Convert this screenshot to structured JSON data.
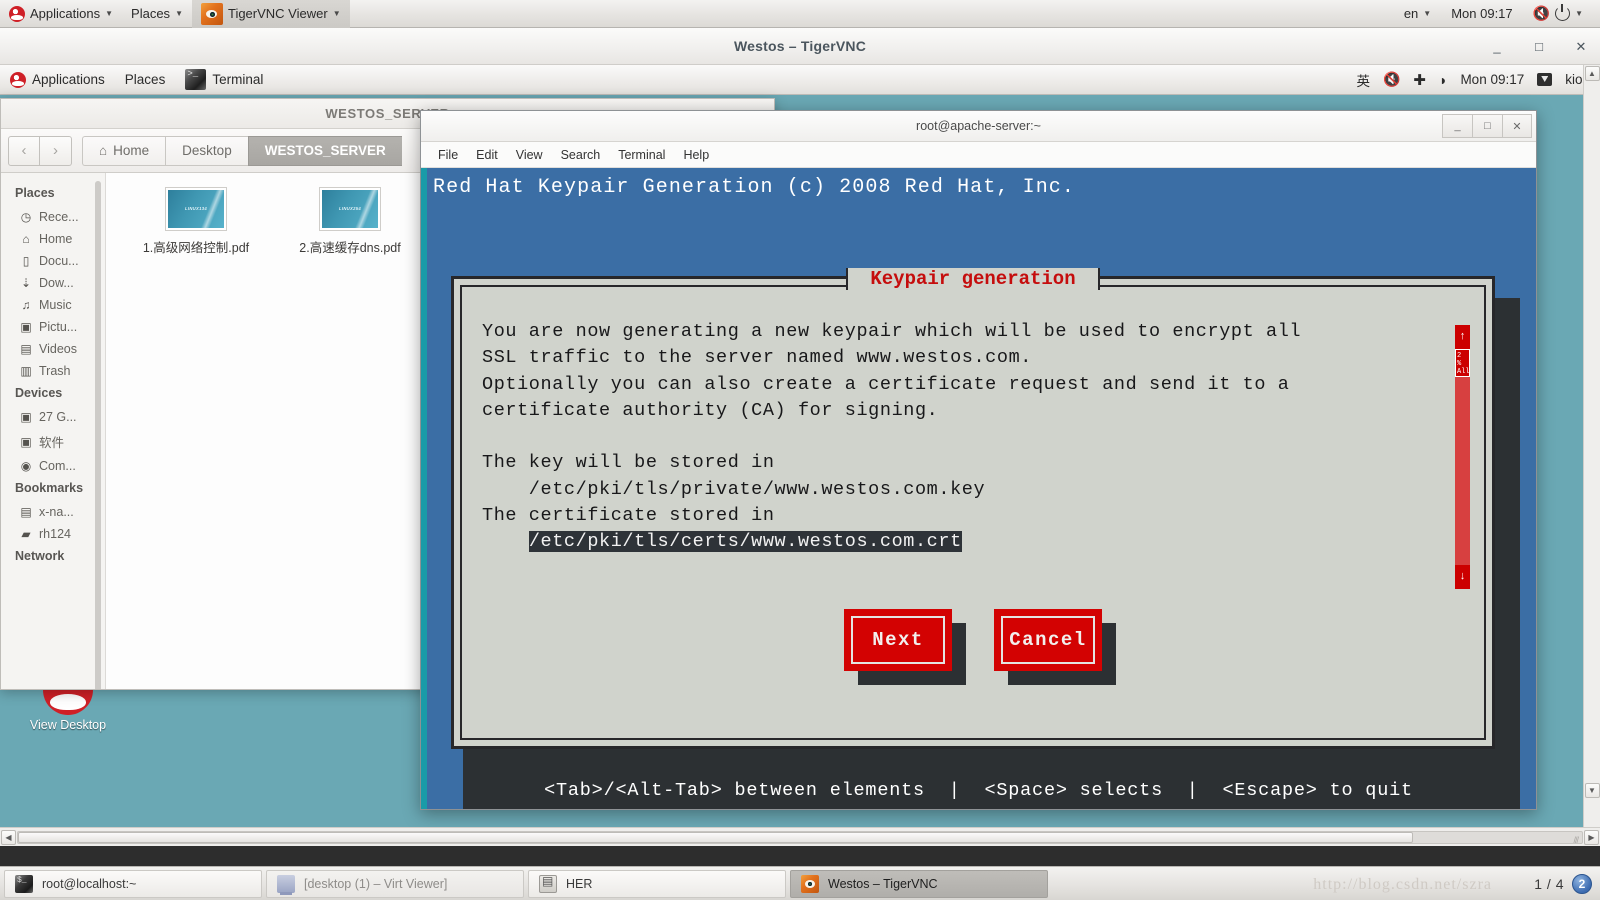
{
  "host_panel": {
    "applications": "Applications",
    "places": "Places",
    "app_window": "TigerVNC Viewer",
    "keyboard": "en",
    "clock": "Mon 09:17"
  },
  "vnc_window": {
    "title": "Westos – TigerVNC",
    "minimize": "_",
    "maximize": "□",
    "close": "✕"
  },
  "guest_panel": {
    "applications": "Applications",
    "places": "Places",
    "window": "Terminal",
    "ime": "英",
    "clock": "Mon 09:17",
    "user": "kiosk"
  },
  "desktop": {
    "icon_label": "View Desktop"
  },
  "file_manager": {
    "title": "WESTOS_SERVER",
    "minimize": "_",
    "close": "⌄",
    "back": "‹",
    "forward": "›",
    "breadcrumbs": [
      {
        "label": "Home",
        "icon": "home-icon",
        "active": false
      },
      {
        "label": "Desktop",
        "icon": "",
        "active": false
      },
      {
        "label": "WESTOS_SERVER",
        "icon": "",
        "active": true
      }
    ],
    "sidebar": [
      {
        "type": "header",
        "label": "Places"
      },
      {
        "type": "item",
        "label": "Rece...",
        "icon": "recent-icon"
      },
      {
        "type": "item",
        "label": "Home",
        "icon": "home-icon"
      },
      {
        "type": "item",
        "label": "Docu...",
        "icon": "document-icon"
      },
      {
        "type": "item",
        "label": "Dow...",
        "icon": "download-icon"
      },
      {
        "type": "item",
        "label": "Music",
        "icon": "music-icon"
      },
      {
        "type": "item",
        "label": "Pictu...",
        "icon": "camera-icon"
      },
      {
        "type": "item",
        "label": "Videos",
        "icon": "film-icon"
      },
      {
        "type": "item",
        "label": "Trash",
        "icon": "trash-icon"
      },
      {
        "type": "header",
        "label": "Devices"
      },
      {
        "type": "item",
        "label": "27 G...",
        "icon": "drive-icon"
      },
      {
        "type": "item",
        "label": "软件",
        "icon": "drive-icon"
      },
      {
        "type": "item",
        "label": "Com...",
        "icon": "disc-icon"
      },
      {
        "type": "header",
        "label": "Bookmarks"
      },
      {
        "type": "item",
        "label": "x-na...",
        "icon": "computer-icon"
      },
      {
        "type": "item",
        "label": "rh124",
        "icon": "folder-icon"
      },
      {
        "type": "header",
        "label": "Network"
      }
    ],
    "files": [
      {
        "name": "1.高级网络控制.pdf",
        "thumb_text": "LINUX134"
      },
      {
        "name": "2.高速缓存dns.pdf",
        "thumb_text": "LINUX254"
      }
    ]
  },
  "terminal": {
    "title": "root@apache-server:~",
    "minimize": "_",
    "maximize": "□",
    "close": "✕",
    "menu": [
      "File",
      "Edit",
      "View",
      "Search",
      "Terminal",
      "Help"
    ],
    "header_line": "Red Hat Keypair Generation (c) 2008 Red Hat, Inc.",
    "dialog": {
      "title": "Keypair generation",
      "body_line1": "You are now generating a new keypair which will be used to encrypt all",
      "body_line2": "SSL traffic to the server named www.westos.com.",
      "body_line3": "Optionally you can also create a certificate request and send it to a",
      "body_line4": "certificate authority (CA) for signing.",
      "body_line5": "The key will be stored in",
      "body_line6": "    /etc/pki/tls/private/www.westos.com.key",
      "body_line7": "The certificate stored in",
      "selected_path": "/etc/pki/tls/certs/www.westos.com.crt",
      "buttons": [
        {
          "label": "Next"
        },
        {
          "label": "Cancel"
        }
      ],
      "scroll_up": "↑",
      "scroll_down": "↓",
      "scroll_marker": "2 %\nAll"
    },
    "status_line": "<Tab>/<Alt-Tab> between elements  |  <Space> selects  |  <Escape> to quit"
  },
  "taskbar": {
    "items": [
      {
        "label": "root@localhost:~",
        "icon": "terminal-icon",
        "state": "normal"
      },
      {
        "label": "[desktop (1) – Virt Viewer]",
        "icon": "virt-viewer-icon",
        "state": "dim"
      },
      {
        "label": "HER",
        "icon": "her-icon",
        "state": "normal"
      },
      {
        "label": "Westos – TigerVNC",
        "icon": "tigervnc-icon",
        "state": "selected"
      }
    ],
    "workspace": "1 / 4",
    "workspace_badge": "2"
  },
  "watermark": "http://blog.csdn.net/szra",
  "colors": {
    "terminal_bg": "#3b6ea5",
    "dialog_bg": "#d0d3cc",
    "dialog_title": "#c50d0d",
    "button_red": "#d30202",
    "desktop": "#6aa8b4"
  }
}
